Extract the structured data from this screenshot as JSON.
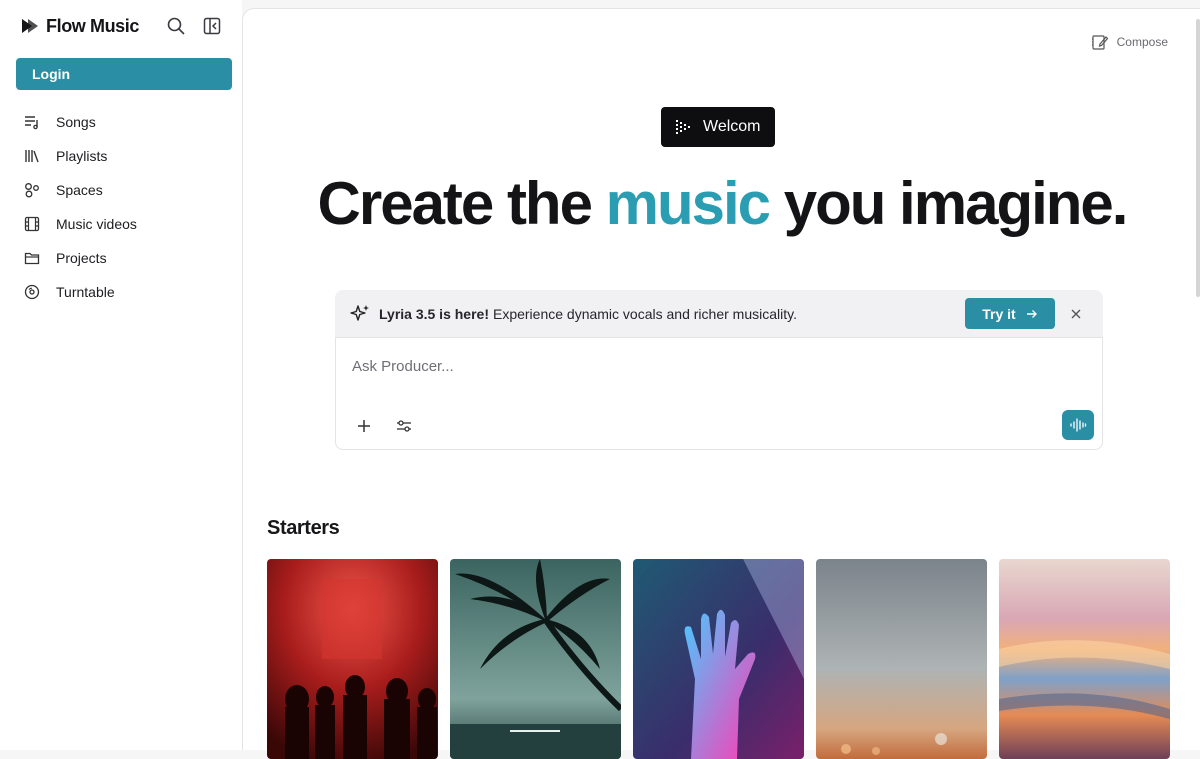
{
  "sidebar": {
    "brand": "Flow Music",
    "login_label": "Login",
    "items": [
      {
        "label": "Songs",
        "icon": "songs-icon"
      },
      {
        "label": "Playlists",
        "icon": "library-icon"
      },
      {
        "label": "Spaces",
        "icon": "spaces-icon"
      },
      {
        "label": "Music videos",
        "icon": "film-icon"
      },
      {
        "label": "Projects",
        "icon": "folder-icon"
      },
      {
        "label": "Turntable",
        "icon": "turntable-icon"
      }
    ]
  },
  "header": {
    "compose_label": "Compose"
  },
  "hero": {
    "badge": "Welcom",
    "title_before": "Create the ",
    "title_accent": "music",
    "title_after": " you imagine."
  },
  "banner": {
    "headline": "Lyria 3.5 is here!",
    "text": "Experience dynamic vocals and richer musicality.",
    "cta": "Try it"
  },
  "composer": {
    "placeholder": "Ask Producer..."
  },
  "starters": {
    "title": "Starters",
    "cards": [
      "red-crowd",
      "palm-tree",
      "neon-hand",
      "sunset-blur",
      "color-streaks"
    ]
  },
  "colors": {
    "accent": "#2a8fa5",
    "hero_accent": "#2a9db3"
  }
}
